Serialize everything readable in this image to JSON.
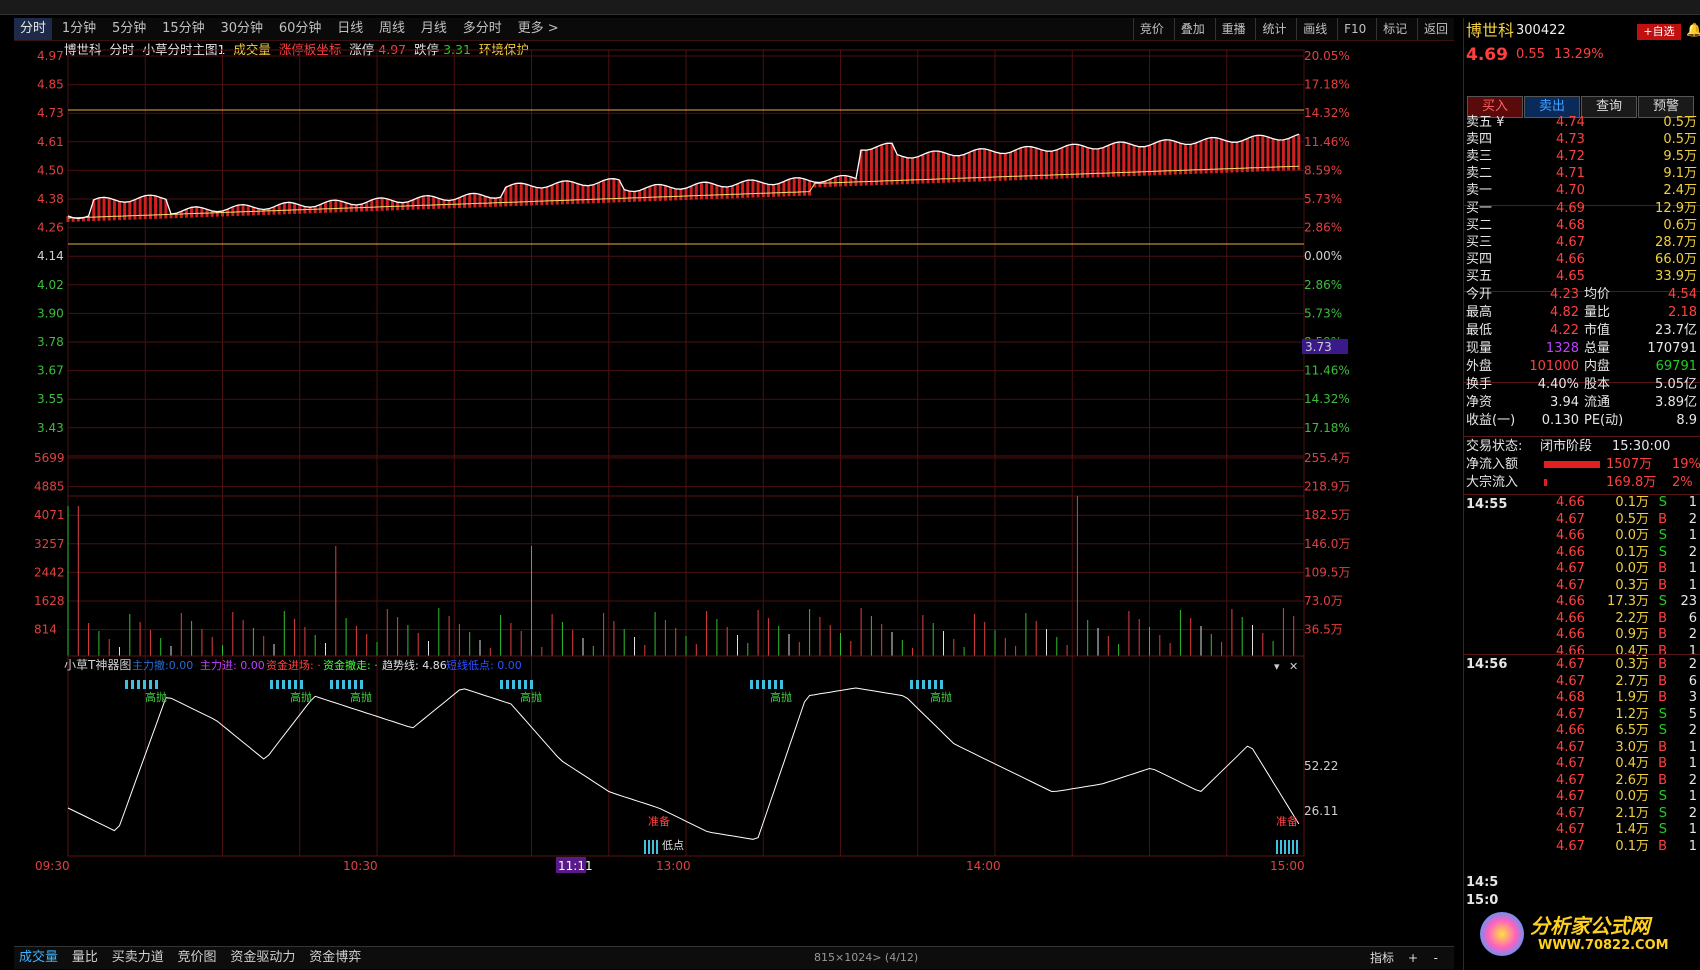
{
  "tabs": [
    "分时",
    "1分钟",
    "5分钟",
    "15分钟",
    "30分钟",
    "60分钟",
    "日线",
    "周线",
    "月线",
    "多分时",
    "更多 >"
  ],
  "right_tools": [
    "竞价",
    "叠加",
    "重播",
    "统计",
    "画线",
    "F10",
    "标记",
    "返回"
  ],
  "chart_header": {
    "name": "博世科",
    "mode": "分时",
    "template": "小草分时主图1",
    "volume_label": "成交量",
    "limit_label": "涨停板坐标",
    "up_label": "涨停",
    "up_value": "4.97",
    "down_label": "跌停",
    "down_value": "3.31",
    "env_label": "环境保护"
  },
  "price_axis_left": [
    "4.97",
    "4.85",
    "4.73",
    "4.61",
    "4.50",
    "4.38",
    "4.26",
    "4.14",
    "4.02",
    "3.90",
    "3.78",
    "3.67",
    "3.55",
    "3.43"
  ],
  "pct_axis_right": [
    "20.05%",
    "17.18%",
    "14.32%",
    "11.46%",
    "8.59%",
    "5.73%",
    "2.86%",
    "0.00%",
    "2.86%",
    "5.73%",
    "8.59%",
    "11.46%",
    "14.32%",
    "17.18%"
  ],
  "price_cursor": "3.73",
  "vol_axis_left": [
    "5699",
    "4885",
    "4071",
    "3257",
    "2442",
    "1628",
    "814"
  ],
  "vol_axis_right": [
    "255.4万",
    "218.9万",
    "182.5万",
    "146.0万",
    "109.5万",
    "73.0万",
    "36.5万"
  ],
  "indicator": {
    "title": "小草T神器图",
    "main_sell": "主力撤:0.00",
    "main_in": "主力进: 0.00",
    "fund_in": "资金进场: ·",
    "fund_out": "资金撤走: ·",
    "trend": "趋势线: 4.86",
    "trend_low": "短线低点: 0.00",
    "label_high": "高抛",
    "label_ready": "准备",
    "label_low": "低点",
    "axis": [
      "52.22",
      "26.11"
    ]
  },
  "time_axis": [
    "09:30",
    "10:30",
    "11:11",
    "13:00",
    "14:00",
    "15:00"
  ],
  "bottom_tabs": [
    "成交量",
    "量比",
    "买卖力道",
    "竞价图",
    "资金驱动力",
    "资金博弈"
  ],
  "bottom_info": "815×1024> (4/12)",
  "bottom_right": [
    "指标",
    "+",
    "-"
  ],
  "stock": {
    "name": "博世科",
    "code": "300422",
    "price": "4.69",
    "change": "0.55",
    "pct": "13.29%",
    "fav": "+自选"
  },
  "trade_buttons": [
    "买入",
    "卖出",
    "查询",
    "预警"
  ],
  "asks": [
    {
      "label": "卖五 ¥",
      "price": "4.74",
      "vol": "0.5万"
    },
    {
      "label": "卖四",
      "price": "4.73",
      "vol": "0.5万"
    },
    {
      "label": "卖三",
      "price": "4.72",
      "vol": "9.5万"
    },
    {
      "label": "卖二",
      "price": "4.71",
      "vol": "9.1万"
    },
    {
      "label": "卖一",
      "price": "4.70",
      "vol": "2.4万"
    }
  ],
  "bids": [
    {
      "label": "买一",
      "price": "4.69",
      "vol": "12.9万"
    },
    {
      "label": "买二",
      "price": "4.68",
      "vol": "0.6万"
    },
    {
      "label": "买三",
      "price": "4.67",
      "vol": "28.7万"
    },
    {
      "label": "买四",
      "price": "4.66",
      "vol": "66.0万"
    },
    {
      "label": "买五",
      "price": "4.65",
      "vol": "33.9万"
    }
  ],
  "stats": [
    {
      "k1": "今开",
      "v1": "4.23",
      "k2": "均价",
      "v2": "4.54"
    },
    {
      "k1": "最高",
      "v1": "4.82",
      "k2": "量比",
      "v2": "2.18"
    },
    {
      "k1": "最低",
      "v1": "4.22",
      "k2": "市值",
      "v2": "23.7亿"
    },
    {
      "k1": "现量",
      "v1": "1328",
      "k2": "总量",
      "v2": "170791"
    },
    {
      "k1": "外盘",
      "v1": "101000",
      "k2": "内盘",
      "v2": "69791"
    }
  ],
  "stats2": [
    {
      "k1": "换手",
      "v1": "4.40%",
      "k2": "股本",
      "v2": "5.05亿"
    },
    {
      "k1": "净资",
      "v1": "3.94",
      "k2": "流通",
      "v2": "3.89亿"
    },
    {
      "k1": "收益(一)",
      "v1": "0.130",
      "k2": "PE(动)",
      "v2": "8.9"
    }
  ],
  "status": {
    "label": "交易状态:",
    "value": "闭市阶段",
    "time": "15:30:00"
  },
  "flows": [
    {
      "label": "净流入额",
      "value": "1507万",
      "pct": "19%"
    },
    {
      "label": "大宗流入",
      "value": "169.8万",
      "pct": "2%"
    }
  ],
  "ticks1_time": "14:55",
  "ticks1": [
    [
      "4.66",
      "0.1万",
      "S",
      "1"
    ],
    [
      "4.67",
      "0.5万",
      "B",
      "2"
    ],
    [
      "4.66",
      "0.0万",
      "S",
      "1"
    ],
    [
      "4.66",
      "0.1万",
      "S",
      "2"
    ],
    [
      "4.67",
      "0.0万",
      "B",
      "1"
    ],
    [
      "4.67",
      "0.3万",
      "B",
      "1"
    ],
    [
      "4.66",
      "17.3万",
      "S",
      "23"
    ],
    [
      "4.66",
      "2.2万",
      "B",
      "6"
    ],
    [
      "4.66",
      "0.9万",
      "B",
      "2"
    ],
    [
      "4.66",
      "0.4万",
      "B",
      "1"
    ]
  ],
  "ticks2_time": "14:56",
  "ticks2": [
    [
      "4.67",
      "0.3万",
      "B",
      "2"
    ],
    [
      "4.67",
      "2.7万",
      "B",
      "6"
    ],
    [
      "4.68",
      "1.9万",
      "B",
      "3"
    ],
    [
      "4.67",
      "1.2万",
      "S",
      "5"
    ],
    [
      "4.66",
      "6.5万",
      "S",
      "2"
    ],
    [
      "4.67",
      "3.0万",
      "B",
      "1"
    ],
    [
      "4.67",
      "0.4万",
      "B",
      "1"
    ],
    [
      "4.67",
      "2.6万",
      "B",
      "2"
    ],
    [
      "4.67",
      "0.0万",
      "S",
      "1"
    ],
    [
      "4.67",
      "2.1万",
      "S",
      "2"
    ],
    [
      "4.67",
      "1.4万",
      "S",
      "1"
    ],
    [
      "4.67",
      "0.1万",
      "B",
      "1"
    ]
  ],
  "tick_times_bottom": [
    "14:5",
    "15:0"
  ],
  "logo": {
    "text": "分析家公式网",
    "url": "WWW.70822.COM"
  }
}
